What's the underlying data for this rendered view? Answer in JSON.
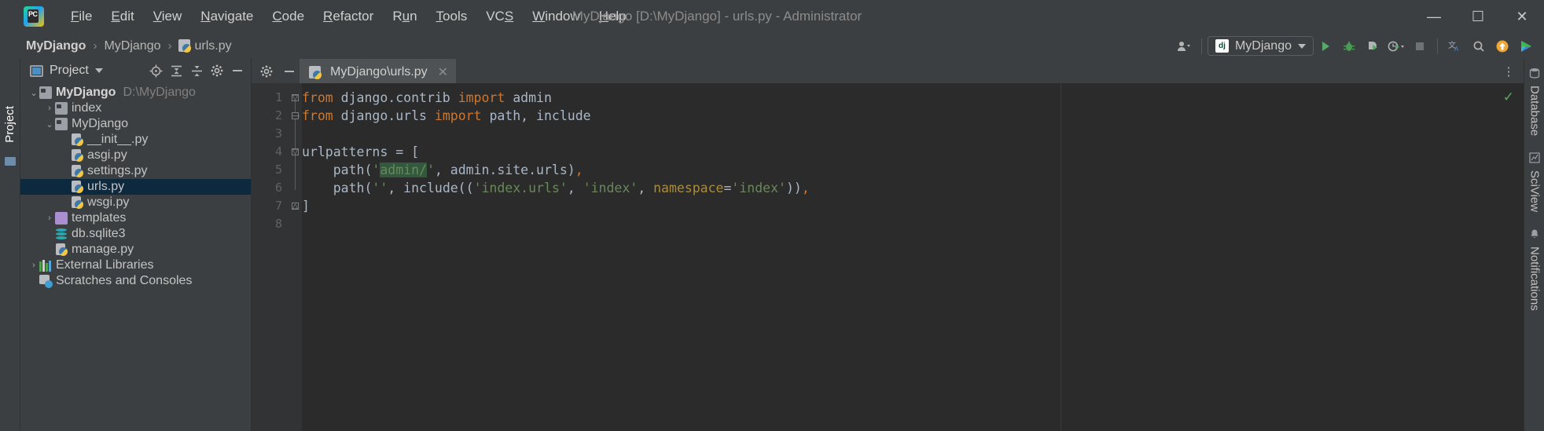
{
  "window": {
    "title": "MyDjango [D:\\MyDjango] - urls.py - Administrator",
    "minimize_label": "—",
    "maximize_label": "☐",
    "close_label": "✕",
    "logo_label": "PC"
  },
  "menubar": {
    "items": [
      {
        "label": "File",
        "mnemonic": "F"
      },
      {
        "label": "Edit",
        "mnemonic": "E"
      },
      {
        "label": "View",
        "mnemonic": "V"
      },
      {
        "label": "Navigate",
        "mnemonic": "N"
      },
      {
        "label": "Code",
        "mnemonic": "C"
      },
      {
        "label": "Refactor",
        "mnemonic": "R"
      },
      {
        "label": "Run",
        "mnemonic": "u"
      },
      {
        "label": "Tools",
        "mnemonic": "T"
      },
      {
        "label": "VCS",
        "mnemonic": "S"
      },
      {
        "label": "Window",
        "mnemonic": "W"
      },
      {
        "label": "Help",
        "mnemonic": "H"
      }
    ]
  },
  "breadcrumb": {
    "items": [
      {
        "label": "MyDjango",
        "bold": true,
        "icon": ""
      },
      {
        "label": "MyDjango",
        "bold": false,
        "icon": ""
      },
      {
        "label": "urls.py",
        "bold": false,
        "icon": "python-file-icon"
      }
    ],
    "separator": "›"
  },
  "toolbar": {
    "account_icon": "user-account-icon",
    "run_config": {
      "label": "MyDjango",
      "badge": "dj",
      "dropdown_icon": "chevron-down-icon"
    },
    "buttons": [
      {
        "name": "run-button",
        "icon": "run-play-icon",
        "color": "#59a869"
      },
      {
        "name": "debug-button",
        "icon": "debug-bug-icon",
        "color": "#3d9140"
      },
      {
        "name": "coverage-button",
        "icon": "coverage-icon",
        "color": "#59a869"
      },
      {
        "name": "profile-button",
        "icon": "profiler-icon",
        "color": "#59a869"
      },
      {
        "name": "stop-button",
        "icon": "stop-square-icon",
        "color": "#6e7275"
      },
      {
        "name": "translate-button",
        "icon": "translate-icon",
        "color": "#5b9bd5"
      },
      {
        "name": "search-button",
        "icon": "search-icon",
        "color": "#b4b4b4"
      },
      {
        "name": "update-button",
        "icon": "update-arrow-icon",
        "color": "#f0a732"
      },
      {
        "name": "ide-feature-button",
        "icon": "colorful-play-icon",
        "color": "#4dbbd5"
      }
    ]
  },
  "left_strip": {
    "tabs": [
      {
        "label": "Project",
        "active": true
      }
    ]
  },
  "project_panel": {
    "header": {
      "title": "Project",
      "dropdown_icon": "chevron-down-icon",
      "actions": [
        {
          "name": "locate-file-icon",
          "glyph": "⊕"
        },
        {
          "name": "expand-all-icon",
          "glyph": "⩒"
        },
        {
          "name": "collapse-all-icon",
          "glyph": "⩓"
        },
        {
          "name": "settings-gear-icon",
          "glyph": "⚙"
        },
        {
          "name": "hide-panel-icon",
          "glyph": "—"
        }
      ]
    },
    "tree": [
      {
        "label": "MyDjango",
        "path": "D:\\MyDjango",
        "icon": "folder-icon",
        "indent": 0,
        "arrow": "down",
        "bold": true,
        "selected": false
      },
      {
        "label": "index",
        "path": "",
        "icon": "folder-icon",
        "indent": 1,
        "arrow": "right",
        "bold": false,
        "selected": false
      },
      {
        "label": "MyDjango",
        "path": "",
        "icon": "folder-icon",
        "indent": 1,
        "arrow": "down",
        "bold": false,
        "selected": false
      },
      {
        "label": "__init__.py",
        "path": "",
        "icon": "python-file-icon",
        "indent": 2,
        "arrow": "none",
        "bold": false,
        "selected": false
      },
      {
        "label": "asgi.py",
        "path": "",
        "icon": "python-file-icon",
        "indent": 2,
        "arrow": "none",
        "bold": false,
        "selected": false
      },
      {
        "label": "settings.py",
        "path": "",
        "icon": "python-file-icon",
        "indent": 2,
        "arrow": "none",
        "bold": false,
        "selected": false
      },
      {
        "label": "urls.py",
        "path": "",
        "icon": "python-file-icon",
        "indent": 2,
        "arrow": "none",
        "bold": false,
        "selected": true
      },
      {
        "label": "wsgi.py",
        "path": "",
        "icon": "python-file-icon",
        "indent": 2,
        "arrow": "none",
        "bold": false,
        "selected": false
      },
      {
        "label": "templates",
        "path": "",
        "icon": "folder-purple-icon",
        "indent": 1,
        "arrow": "right",
        "bold": false,
        "selected": false
      },
      {
        "label": "db.sqlite3",
        "path": "",
        "icon": "database-icon",
        "indent": 1,
        "arrow": "none",
        "bold": false,
        "selected": false
      },
      {
        "label": "manage.py",
        "path": "",
        "icon": "python-file-icon",
        "indent": 1,
        "arrow": "none",
        "bold": false,
        "selected": false
      },
      {
        "label": "External Libraries",
        "path": "",
        "icon": "library-icon",
        "indent": 0,
        "arrow": "right",
        "bold": false,
        "selected": false
      },
      {
        "label": "Scratches and Consoles",
        "path": "",
        "icon": "scratch-icon",
        "indent": 0,
        "arrow": "none",
        "bold": false,
        "selected": false
      }
    ]
  },
  "editor": {
    "tab": {
      "label": "MyDjango\\urls.py",
      "icon": "python-file-icon",
      "close_icon": "✕"
    },
    "tab_actions": [
      {
        "name": "settings-gear-icon",
        "glyph": "⚙"
      },
      {
        "name": "hide-editor-icon",
        "glyph": "—"
      }
    ],
    "options_icon": "⋮",
    "inspection_status_icon": "✓",
    "line_numbers": [
      "1",
      "2",
      "3",
      "4",
      "5",
      "6",
      "7",
      "8"
    ],
    "lines": [
      {
        "n": 1,
        "fold": "open",
        "tokens": [
          {
            "t": "from ",
            "c": "kw"
          },
          {
            "t": "django.contrib ",
            "c": "txt"
          },
          {
            "t": "import ",
            "c": "kw"
          },
          {
            "t": "admin",
            "c": "txt"
          }
        ]
      },
      {
        "n": 2,
        "fold": "end",
        "tokens": [
          {
            "t": "from ",
            "c": "kw"
          },
          {
            "t": "django.urls ",
            "c": "txt"
          },
          {
            "t": "import ",
            "c": "kw"
          },
          {
            "t": "path, include",
            "c": "txt"
          }
        ]
      },
      {
        "n": 3,
        "fold": "none",
        "tokens": []
      },
      {
        "n": 4,
        "fold": "open",
        "tokens": [
          {
            "t": "urlpatterns = [",
            "c": "txt"
          }
        ]
      },
      {
        "n": 5,
        "fold": "none",
        "tokens": [
          {
            "t": "    path(",
            "c": "txt"
          },
          {
            "t": "'",
            "c": "str"
          },
          {
            "t": "admin/",
            "c": "strhl"
          },
          {
            "t": "'",
            "c": "str"
          },
          {
            "t": ", admin.site.urls)",
            "c": "txt"
          },
          {
            "t": ",",
            "c": "kw"
          }
        ]
      },
      {
        "n": 6,
        "fold": "none",
        "tokens": [
          {
            "t": "    path(",
            "c": "txt"
          },
          {
            "t": "''",
            "c": "str"
          },
          {
            "t": ", include((",
            "c": "txt"
          },
          {
            "t": "'index.urls'",
            "c": "str"
          },
          {
            "t": ", ",
            "c": "txt"
          },
          {
            "t": "'index'",
            "c": "str"
          },
          {
            "t": ", ",
            "c": "txt"
          },
          {
            "t": "namespace",
            "c": "kwarg"
          },
          {
            "t": "=",
            "c": "txt"
          },
          {
            "t": "'index'",
            "c": "str"
          },
          {
            "t": "))",
            "c": "txt"
          },
          {
            "t": ",",
            "c": "kw"
          }
        ]
      },
      {
        "n": 7,
        "fold": "close",
        "tokens": [
          {
            "t": "]",
            "c": "txt"
          }
        ]
      },
      {
        "n": 8,
        "fold": "none",
        "tokens": []
      }
    ]
  },
  "right_strip": {
    "tabs": [
      {
        "label": "Database",
        "icon": "database-icon"
      },
      {
        "label": "SciView",
        "icon": "sciview-icon"
      },
      {
        "label": "Notifications",
        "icon": "bell-icon"
      }
    ]
  },
  "colors": {
    "panel_bg": "#3c3f41",
    "editor_bg": "#2b2b2b",
    "gutter_bg": "#313335",
    "selection_bg": "#0d293e",
    "keyword": "#cc7832",
    "string": "#6a8759",
    "string_highlight_bg": "#32593d",
    "kwarg": "#aa8b3c",
    "text": "#a9b7c6",
    "accent_green": "#59a869"
  }
}
